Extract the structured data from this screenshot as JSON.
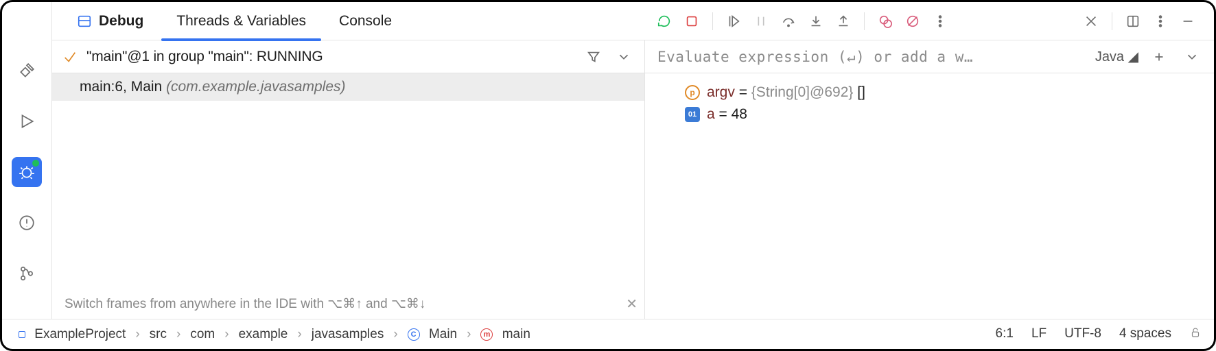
{
  "leftRail": {
    "tooltips": [
      "Build",
      "Run",
      "Debug",
      "Problems",
      "Version Control"
    ]
  },
  "tabs": {
    "debug": "Debug",
    "threads": "Threads & Variables",
    "console": "Console"
  },
  "toolbar": {
    "rerun": "Rerun",
    "stop": "Stop",
    "resume": "Resume",
    "pause": "Pause",
    "stepOver": "Step Over",
    "stepInto": "Step Into",
    "stepOut": "Step Out",
    "breakpoints": "View Breakpoints",
    "mute": "Mute Breakpoints",
    "more": "More",
    "close": "Close",
    "layout": "Layout",
    "options": "Options",
    "minimize": "Minimize"
  },
  "frames": {
    "thread": "\"main\"@1 in group \"main\": RUNNING",
    "items": [
      {
        "label": "main:6, Main ",
        "pkg": "(com.example.javasamples)"
      }
    ],
    "tip": "Switch frames from anywhere in the IDE with ⌥⌘↑ and ⌥⌘↓"
  },
  "vars": {
    "placeholder": "Evaluate expression (↵) or add a w…",
    "lang": "Java ◢",
    "rows": [
      {
        "badge": "p",
        "name": "argv",
        "eq": " = ",
        "ref": "{String[0]@692} ",
        "tail": "[]"
      },
      {
        "badge": "01",
        "name": "a",
        "eq": " = ",
        "ref": "",
        "tail": "48"
      }
    ]
  },
  "breadcrumbs": {
    "items": [
      "ExampleProject",
      "src",
      "com",
      "example",
      "javasamples",
      "Main",
      "main"
    ]
  },
  "status": {
    "caret": "6:1",
    "lineSep": "LF",
    "encoding": "UTF-8",
    "indent": "4 spaces"
  }
}
